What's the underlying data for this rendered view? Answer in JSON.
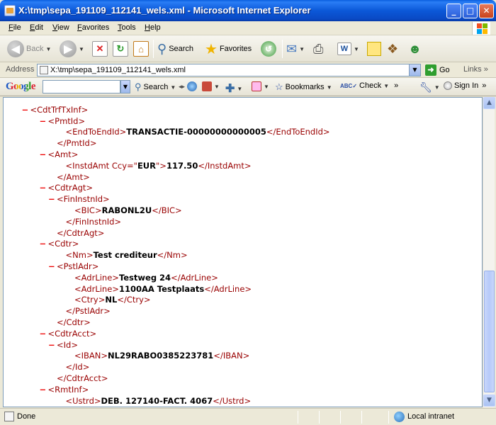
{
  "window": {
    "title": "X:\\tmp\\sepa_191109_112141_wels.xml - Microsoft Internet Explorer",
    "minimize": "_",
    "maximize": "□",
    "close": "✕"
  },
  "menu": [
    "File",
    "Edit",
    "View",
    "Favorites",
    "Tools",
    "Help"
  ],
  "toolbar": {
    "back": "Back",
    "search": "Search",
    "favorites": "Favorites"
  },
  "address": {
    "label": "Address",
    "value": "X:\\tmp\\sepa_191109_112141_wels.xml",
    "go": "Go",
    "links": "Links"
  },
  "google_bar": {
    "logo": "Google",
    "search": "Search",
    "bookmarks": "Bookmarks",
    "check": "Check",
    "sign_in": "Sign In"
  },
  "xml_lines": [
    {
      "indent": 3,
      "minus": "",
      "open": "",
      "text": "",
      "close": "",
      "partial": true
    },
    {
      "indent": 3,
      "minus": "−",
      "open": "<CdtTrfTxInf>",
      "text": "",
      "close": ""
    },
    {
      "indent": 5,
      "minus": "−",
      "open": "<PmtId>",
      "text": "",
      "close": ""
    },
    {
      "indent": 7,
      "minus": "",
      "open": "<EndToEndId>",
      "text": "TRANSACTIE-00000000000005",
      "close": "</EndToEndId>"
    },
    {
      "indent": 6,
      "minus": "",
      "open": "</PmtId>",
      "text": "",
      "close": ""
    },
    {
      "indent": 5,
      "minus": "−",
      "open": "<Amt>",
      "text": "",
      "close": ""
    },
    {
      "indent": 7,
      "minus": "",
      "open": "<InstdAmt Ccy=\"",
      "attr": "EUR",
      "open2": "\">",
      "text": "117.50",
      "close": "</InstdAmt>"
    },
    {
      "indent": 6,
      "minus": "",
      "open": "</Amt>",
      "text": "",
      "close": ""
    },
    {
      "indent": 5,
      "minus": "−",
      "open": "<CdtrAgt>",
      "text": "",
      "close": ""
    },
    {
      "indent": 6,
      "minus": "−",
      "open": "<FinInstnId>",
      "text": "",
      "close": ""
    },
    {
      "indent": 8,
      "minus": "",
      "open": "<BIC>",
      "text": "RABONL2U",
      "close": "</BIC>"
    },
    {
      "indent": 7,
      "minus": "",
      "open": "</FinInstnId>",
      "text": "",
      "close": ""
    },
    {
      "indent": 6,
      "minus": "",
      "open": "</CdtrAgt>",
      "text": "",
      "close": ""
    },
    {
      "indent": 5,
      "minus": "−",
      "open": "<Cdtr>",
      "text": "",
      "close": ""
    },
    {
      "indent": 7,
      "minus": "",
      "open": "<Nm>",
      "text": "Test crediteur",
      "close": "</Nm>"
    },
    {
      "indent": 6,
      "minus": "−",
      "open": "<PstlAdr>",
      "text": "",
      "close": ""
    },
    {
      "indent": 8,
      "minus": "",
      "open": "<AdrLine>",
      "text": "Testweg 24",
      "close": "</AdrLine>"
    },
    {
      "indent": 8,
      "minus": "",
      "open": "<AdrLine>",
      "text": "1100AA Testplaats",
      "close": "</AdrLine>"
    },
    {
      "indent": 8,
      "minus": "",
      "open": "<Ctry>",
      "text": "NL",
      "close": "</Ctry>"
    },
    {
      "indent": 7,
      "minus": "",
      "open": "</PstlAdr>",
      "text": "",
      "close": ""
    },
    {
      "indent": 6,
      "minus": "",
      "open": "</Cdtr>",
      "text": "",
      "close": ""
    },
    {
      "indent": 5,
      "minus": "−",
      "open": "<CdtrAcct>",
      "text": "",
      "close": ""
    },
    {
      "indent": 6,
      "minus": "−",
      "open": "<Id>",
      "text": "",
      "close": ""
    },
    {
      "indent": 8,
      "minus": "",
      "open": "<IBAN>",
      "text": "NL29RABO0385223781",
      "close": "</IBAN>"
    },
    {
      "indent": 7,
      "minus": "",
      "open": "</Id>",
      "text": "",
      "close": ""
    },
    {
      "indent": 6,
      "minus": "",
      "open": "</CdtrAcct>",
      "text": "",
      "close": ""
    },
    {
      "indent": 5,
      "minus": "−",
      "open": "<RmtInf>",
      "text": "",
      "close": ""
    },
    {
      "indent": 7,
      "minus": "",
      "open": "<Ustrd>",
      "text": "DEB. 127140-FACT. 4067",
      "close": "</Ustrd>"
    }
  ],
  "status": {
    "text": "Done",
    "zone": "Local intranet"
  }
}
